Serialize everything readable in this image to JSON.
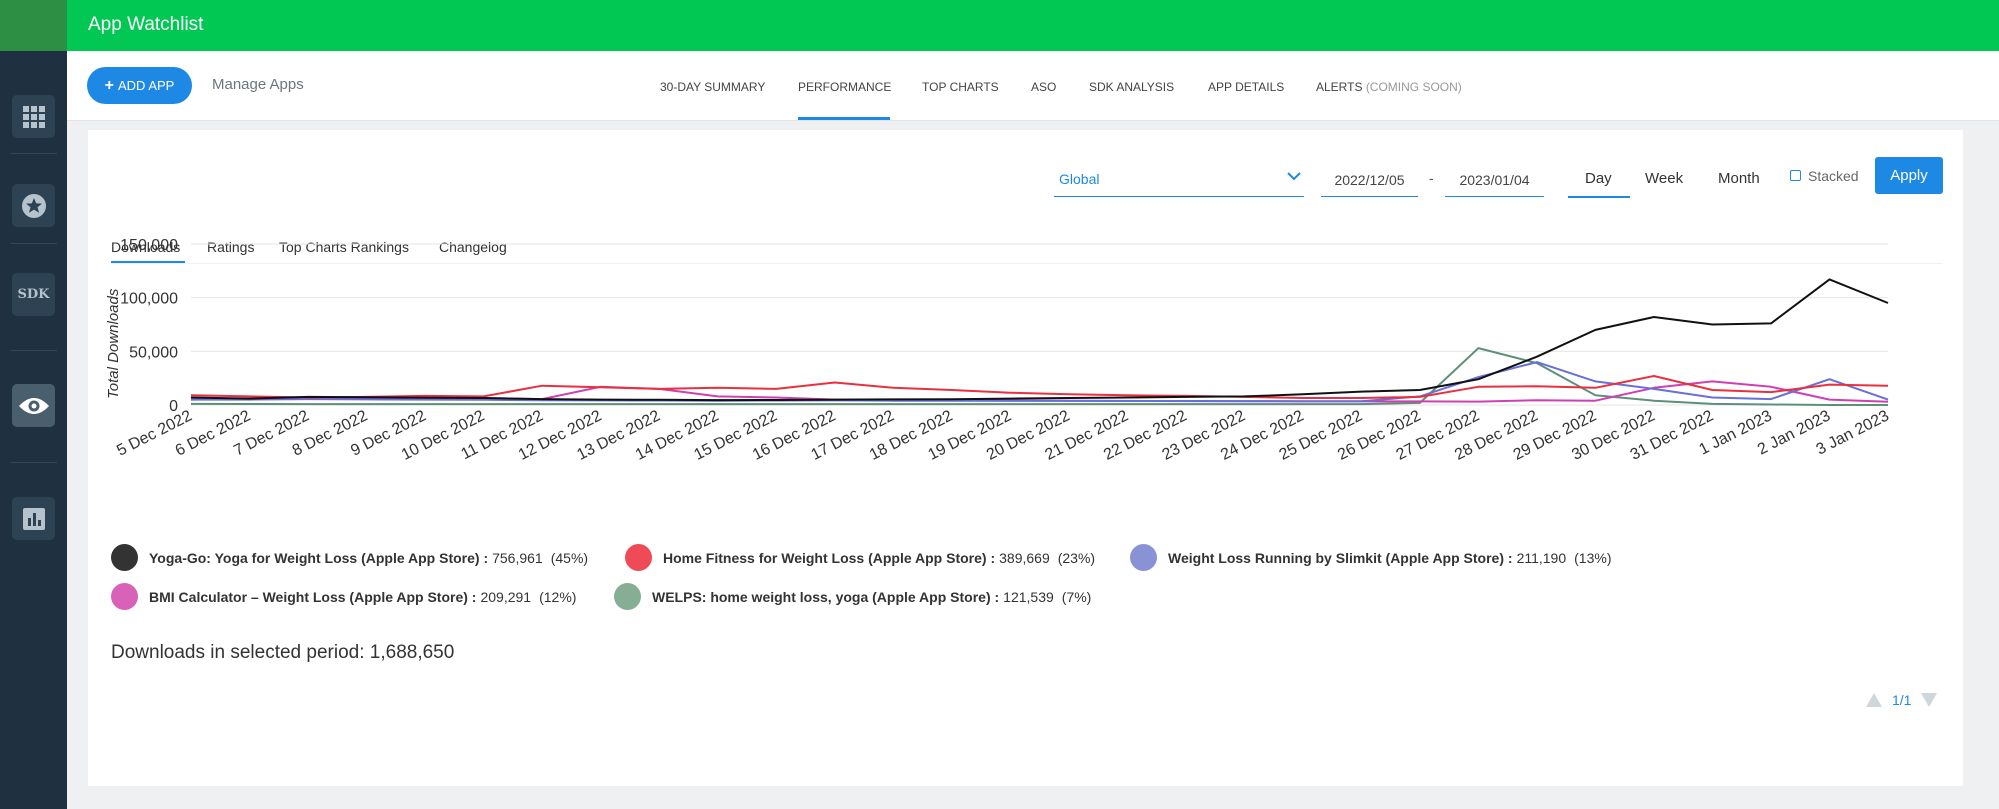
{
  "app": {
    "title": "App Watchlist"
  },
  "sidebar": {
    "items": [
      {
        "icon": "grid-icon"
      },
      {
        "icon": "star-icon"
      },
      {
        "icon": "sdk-icon",
        "label": "SDK"
      },
      {
        "icon": "eye-icon",
        "active": true
      },
      {
        "icon": "bar-chart-icon"
      }
    ]
  },
  "nav": {
    "add_app": "ADD APP",
    "manage_apps": "Manage Apps",
    "tabs": [
      "30-DAY SUMMARY",
      "PERFORMANCE",
      "TOP CHARTS",
      "ASO",
      "SDK ANALYSIS",
      "APP DETAILS",
      "ALERTS"
    ],
    "alerts_suffix": "(COMING SOON)",
    "active_tab": "PERFORMANCE"
  },
  "filters": {
    "region": "Global",
    "start_date": "2022/12/05",
    "date_separator": "-",
    "end_date": "2023/01/04",
    "periods": [
      "Day",
      "Week",
      "Month"
    ],
    "active_period": "Day",
    "stacked_label": "Stacked",
    "stacked_checked": false,
    "apply": "Apply"
  },
  "subtabs": {
    "items": [
      "Downloads",
      "Ratings",
      "Top Charts Rankings",
      "Changelog"
    ],
    "active": "Downloads"
  },
  "summary": {
    "label": "Downloads in selected period:",
    "total": "1,688,650"
  },
  "legend": [
    {
      "name": "Yoga-Go: Yoga for Weight Loss (Apple App Store) :",
      "value": "756,961",
      "pct": "(45%)",
      "color": "#333333"
    },
    {
      "name": "Home Fitness for Weight Loss (Apple App Store) :",
      "value": "389,669",
      "pct": "(23%)",
      "color": "#ef4b57"
    },
    {
      "name": "Weight Loss Running by Slimkit (Apple App Store) :",
      "value": "211,190",
      "pct": "(13%)",
      "color": "#8a92d6"
    },
    {
      "name": "BMI Calculator – Weight Loss (Apple App Store) :",
      "value": "209,291",
      "pct": "(12%)",
      "color": "#d862b8"
    },
    {
      "name": "WELPS: home weight loss, yoga (Apple App Store) :",
      "value": "121,539",
      "pct": "(7%)",
      "color": "#86ae95"
    }
  ],
  "pager": {
    "label": "1/1"
  },
  "chart_data": {
    "type": "line",
    "ylabel": "Total Downloads",
    "xlabel": "",
    "ylim": [
      0,
      150000
    ],
    "yticks": [
      0,
      50000,
      100000,
      150000
    ],
    "ytick_labels": [
      "0",
      "50,000",
      "100,000",
      "150,000"
    ],
    "grid": true,
    "categories": [
      "5 Dec 2022",
      "6 Dec 2022",
      "7 Dec 2022",
      "8 Dec 2022",
      "9 Dec 2022",
      "10 Dec 2022",
      "11 Dec 2022",
      "12 Dec 2022",
      "13 Dec 2022",
      "14 Dec 2022",
      "15 Dec 2022",
      "16 Dec 2022",
      "17 Dec 2022",
      "18 Dec 2022",
      "19 Dec 2022",
      "20 Dec 2022",
      "21 Dec 2022",
      "22 Dec 2022",
      "23 Dec 2022",
      "24 Dec 2022",
      "25 Dec 2022",
      "26 Dec 2022",
      "27 Dec 2022",
      "28 Dec 2022",
      "29 Dec 2022",
      "30 Dec 2022",
      "31 Dec 2022",
      "1 Jan 2023",
      "2 Jan 2023",
      "3 Jan 2023"
    ],
    "series": [
      {
        "name": "Yoga-Go: Yoga for Weight Loss (Apple App Store)",
        "color": "#111111",
        "values": [
          7000,
          6000,
          7500,
          7200,
          6800,
          6500,
          5500,
          5000,
          4800,
          4600,
          4700,
          5000,
          5200,
          5400,
          6000,
          6500,
          7000,
          7500,
          8000,
          10000,
          12500,
          14000,
          24000,
          45000,
          70000,
          82000,
          75000,
          76000,
          117000,
          95000
        ]
      },
      {
        "name": "Home Fitness for Weight Loss (Apple App Store)",
        "color": "#e8303f",
        "values": [
          9000,
          8000,
          7000,
          7500,
          8500,
          8000,
          18000,
          16500,
          15000,
          16000,
          15000,
          21000,
          16000,
          14000,
          11500,
          10000,
          9000,
          8500,
          7500,
          6500,
          6500,
          7500,
          17000,
          17500,
          16000,
          27000,
          14000,
          12000,
          19000,
          18000
        ]
      },
      {
        "name": "Weight Loss Running by Slimkit (Apple App Store)",
        "color": "#6670d9",
        "values": [
          5000,
          5000,
          5500,
          5200,
          5000,
          4800,
          4500,
          4300,
          4200,
          4000,
          4200,
          4300,
          4000,
          3900,
          3800,
          3800,
          3700,
          3700,
          3600,
          3500,
          3500,
          8000,
          26000,
          40000,
          22000,
          15000,
          7000,
          5500,
          24000,
          5000
        ]
      },
      {
        "name": "BMI Calculator – Weight Loss (Apple App Store)",
        "color": "#cf3fb2",
        "values": [
          5000,
          6000,
          6500,
          6000,
          7000,
          6500,
          5500,
          17000,
          15000,
          8000,
          7000,
          5000,
          4500,
          4300,
          4200,
          4000,
          3800,
          3600,
          3500,
          3400,
          3400,
          3400,
          3200,
          4500,
          4000,
          16000,
          22000,
          17000,
          5000,
          3000
        ]
      },
      {
        "name": "WELPS: home weight loss, yoga (Apple App Store)",
        "color": "#5e9079",
        "values": [
          1000,
          900,
          800,
          800,
          800,
          800,
          800,
          800,
          800,
          800,
          800,
          800,
          800,
          800,
          800,
          800,
          800,
          800,
          800,
          800,
          800,
          2000,
          53000,
          39000,
          9000,
          4000,
          1000,
          500,
          0,
          0
        ]
      }
    ]
  }
}
